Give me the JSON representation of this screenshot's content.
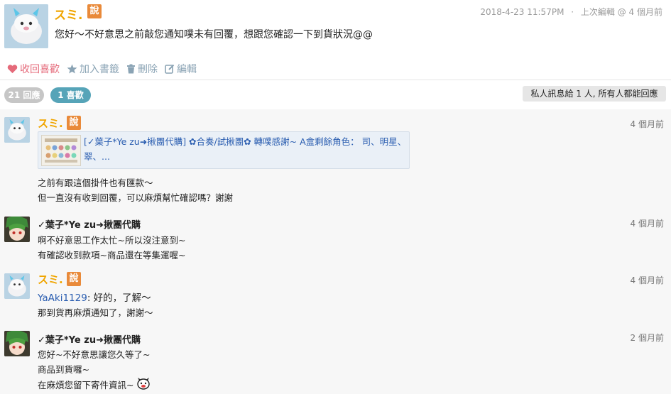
{
  "post": {
    "author": "スミ.",
    "say_badge": "說",
    "datetime": "2018-4-23 11:57PM",
    "meta_sep": "·",
    "edit_meta": "上次編輯 @ 4 個月前",
    "text": "您好～不好意思之前敲您通知噗未有回覆，想跟您確認一下到貨狀況@@"
  },
  "actions": {
    "unlike": "收回喜歡",
    "bookmark": "加入書籤",
    "delete": "刪除",
    "edit": "編輯"
  },
  "stats": {
    "replies": "21 回應",
    "likes": "1 喜歡",
    "private_notice": "私人訊息給 1 人, 所有人都能回應"
  },
  "comments": [
    {
      "author": "スミ.",
      "badge": "說",
      "time": "4 個月前",
      "link_text": "[✓葉子*Ye zu➜揪團代購] ✿合奏/試揪團✿ 轉噗感謝~ A盒剩餘角色： 司、明星、翠、...",
      "lines": [
        "之前有跟這個掛件也有匯款～",
        "但一直沒有收到回覆，可以麻煩幫忙確認嗎？謝謝"
      ]
    },
    {
      "author": "✓葉子*Ye zu➜揪團代購",
      "time": "4 個月前",
      "lines": [
        "啊不好意思工作太忙~所以沒注意到~",
        "有確認收到款項~商品還在等集運喔~"
      ]
    },
    {
      "author": "スミ.",
      "badge": "說",
      "time": "4 個月前",
      "mention": "YaAki1129",
      "mention_rest": ": 好的，了解～",
      "lines": [
        "那到貨再麻煩通知了，謝謝～"
      ]
    },
    {
      "author": "✓葉子*Ye zu➜揪團代購",
      "time": "2 個月前",
      "lines": [
        "您好~不好意思讓您久等了~",
        "商品到貨囉~",
        "在麻煩您留下寄件資訊~"
      ]
    }
  ],
  "colors": {
    "name_orange": "#f0a500",
    "badge_orange": "#e98a3a",
    "likes_pill": "#56a4b8",
    "link_blue": "#2a5db0",
    "unlike_pink": "#e56a7a"
  }
}
